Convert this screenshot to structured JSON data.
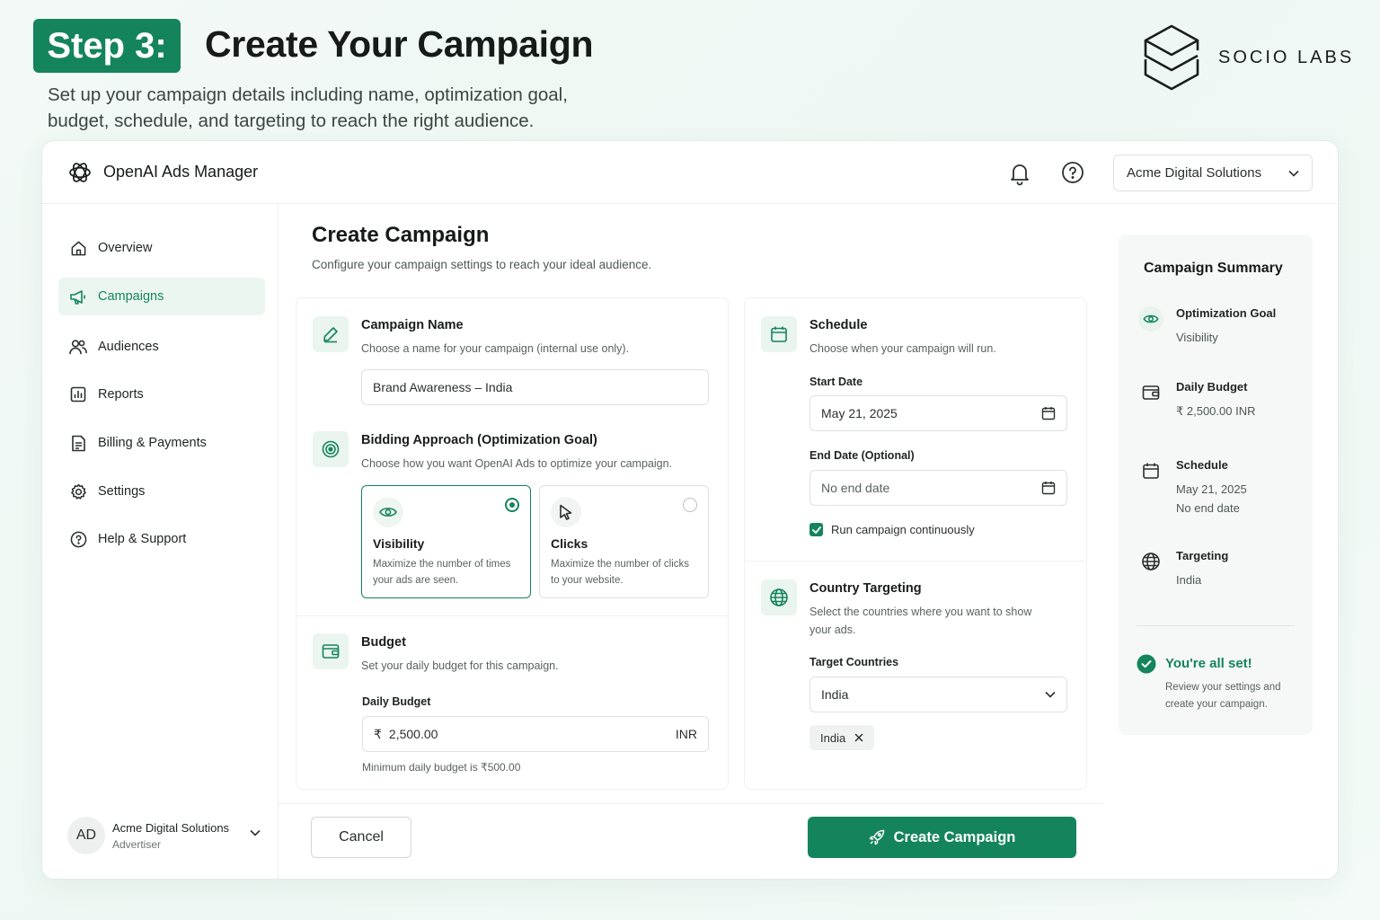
{
  "header": {
    "step_badge": "Step 3:",
    "title": "Create Your Campaign",
    "subtitle": "Set up your campaign details including name, optimization goal, budget, schedule, and targeting to reach the right audience.",
    "brand": "SOCIO LABS"
  },
  "app": {
    "name": "OpenAI Ads Manager",
    "account": "Acme Digital Solutions"
  },
  "sidebar": {
    "items": [
      {
        "label": "Overview",
        "icon": "home-icon"
      },
      {
        "label": "Campaigns",
        "icon": "megaphone-icon",
        "active": true
      },
      {
        "label": "Audiences",
        "icon": "users-icon"
      },
      {
        "label": "Reports",
        "icon": "reports-icon"
      },
      {
        "label": "Billing & Payments",
        "icon": "billing-icon"
      },
      {
        "label": "Settings",
        "icon": "gear-icon"
      },
      {
        "label": "Help & Support",
        "icon": "help-icon"
      }
    ],
    "user": {
      "initials": "AD",
      "name": "Acme Digital Solutions",
      "role": "Advertiser"
    }
  },
  "main": {
    "title": "Create Campaign",
    "subtitle": "Configure your campaign settings to reach your ideal audience."
  },
  "campaign_name": {
    "title": "Campaign Name",
    "desc": "Choose a name for your campaign (internal use only).",
    "value": "Brand Awareness – India"
  },
  "bidding": {
    "title": "Bidding Approach (Optimization Goal)",
    "desc": "Choose how you want OpenAI Ads to optimize your campaign.",
    "options": [
      {
        "title": "Visibility",
        "desc": "Maximize the number of times your ads are seen.",
        "selected": true
      },
      {
        "title": "Clicks",
        "desc": "Maximize the number of clicks to your website.",
        "selected": false
      }
    ]
  },
  "budget": {
    "title": "Budget",
    "desc": "Set your daily budget for this campaign.",
    "label": "Daily Budget",
    "currency_symbol": "₹",
    "value": "2,500.00",
    "currency": "INR",
    "hint": "Minimum daily budget is ₹500.00"
  },
  "schedule": {
    "title": "Schedule",
    "desc": "Choose when your campaign will run.",
    "start_label": "Start Date",
    "start_value": "May 21, 2025",
    "end_label": "End Date (Optional)",
    "end_placeholder": "No end date",
    "continuous_label": "Run campaign continuously",
    "continuous_checked": true
  },
  "targeting": {
    "title": "Country Targeting",
    "desc": "Select the countries where you want to show your ads.",
    "label": "Target Countries",
    "selected": "India",
    "chips": [
      "India"
    ]
  },
  "footer": {
    "cancel": "Cancel",
    "create": "Create Campaign"
  },
  "summary": {
    "title": "Campaign Summary",
    "goal_label": "Optimization Goal",
    "goal_value": "Visibility",
    "budget_label": "Daily Budget",
    "budget_value": "₹ 2,500.00 INR",
    "schedule_label": "Schedule",
    "schedule_start": "May 21, 2025",
    "schedule_end": "No end date",
    "targeting_label": "Targeting",
    "targeting_value": "India",
    "ready_title": "You're all set!",
    "ready_text": "Review your settings and create your campaign."
  },
  "colors": {
    "accent": "#14845c",
    "accent_light": "#eaf5f0",
    "text": "#1b1f1d"
  }
}
